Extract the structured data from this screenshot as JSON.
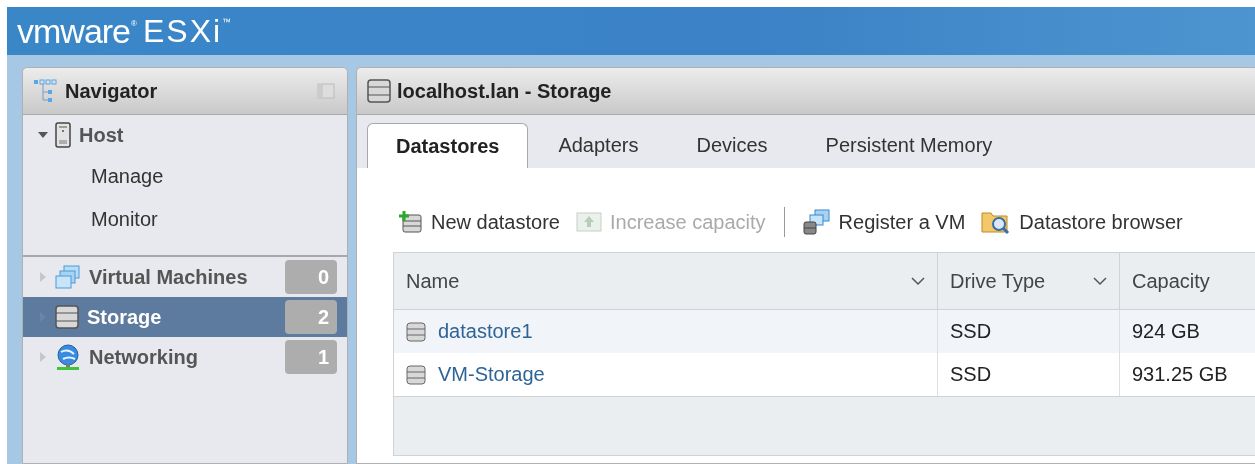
{
  "header": {
    "logo_brand": "vmware",
    "logo_registered": "®",
    "logo_product": "ESXi",
    "logo_trademark": "™"
  },
  "navigator": {
    "title": "Navigator",
    "items": [
      {
        "label": "Host",
        "expanded": true,
        "selected": false,
        "children": [
          {
            "label": "Manage"
          },
          {
            "label": "Monitor"
          }
        ]
      },
      {
        "label": "Virtual Machines",
        "expanded": false,
        "selected": false,
        "count": "0"
      },
      {
        "label": "Storage",
        "expanded": false,
        "selected": true,
        "count": "2"
      },
      {
        "label": "Networking",
        "expanded": false,
        "selected": false,
        "count": "1"
      }
    ]
  },
  "content": {
    "title": "localhost.lan - Storage",
    "tabs": [
      {
        "label": "Datastores",
        "selected": true
      },
      {
        "label": "Adapters",
        "selected": false
      },
      {
        "label": "Devices",
        "selected": false
      },
      {
        "label": "Persistent Memory",
        "selected": false
      }
    ],
    "toolbar": [
      {
        "label": "New datastore",
        "disabled": false
      },
      {
        "label": "Increase capacity",
        "disabled": true
      },
      {
        "label": "Register a VM",
        "disabled": false
      },
      {
        "label": "Datastore browser",
        "disabled": false
      }
    ],
    "table": {
      "columns": [
        {
          "label": "Name",
          "sortable": true
        },
        {
          "label": "Drive Type",
          "sortable": true
        },
        {
          "label": "Capacity"
        }
      ],
      "rows": [
        {
          "name": "datastore1",
          "drive_type": "SSD",
          "capacity": "924 GB"
        },
        {
          "name": "VM-Storage",
          "drive_type": "SSD",
          "capacity": "931.25 GB"
        }
      ]
    }
  }
}
